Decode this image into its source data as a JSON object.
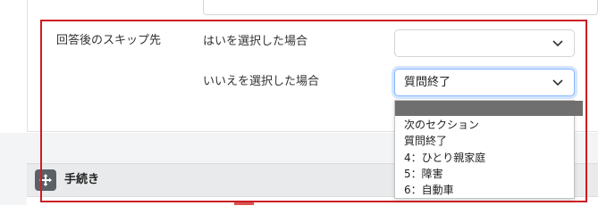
{
  "skip_section": {
    "title": "回答後のスキップ先",
    "yes_label": "はいを選択した場合",
    "no_label": "いいえを選択した場合",
    "yes_value": "",
    "no_value": "質問終了"
  },
  "dropdown": {
    "options": [
      "",
      "次のセクション",
      "質問終了",
      "4：ひとり親家庭",
      "5：障害",
      "6：自動車"
    ],
    "highlighted_index": 0
  },
  "procedure": {
    "title": "手続き"
  },
  "colors": {
    "annotation": "#cc1d23",
    "highlight": "#6f6f6f",
    "focus": "#86b7fe"
  }
}
